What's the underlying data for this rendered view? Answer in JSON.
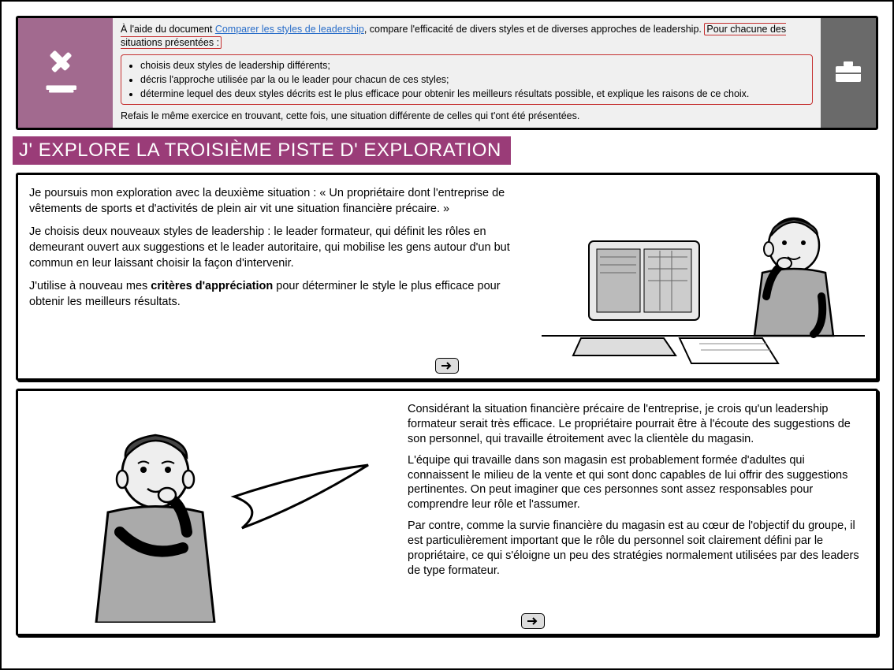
{
  "instruction": {
    "prefix": "À l'aide du document ",
    "link": "Comparer les styles de leadership",
    "mid": ", compare l'efficacité de divers styles et de diverses approches de leadership. ",
    "hl": "Pour chacune des situations présentées :",
    "bullets": [
      "choisis deux styles de leadership différents;",
      "décris l'approche utilisée par la ou le leader pour chacun de ces styles;",
      "détermine lequel des deux styles décrits est le plus efficace pour obtenir les meilleurs résultats possible, et explique les raisons de ce choix."
    ],
    "footer": "Refais le même exercice en trouvant, cette fois, une situation différente de celles qui t'ont été présentées."
  },
  "section_title": "J' EXPLORE LA TROISIÈME PISTE D' EXPLORATION",
  "panel1": {
    "p1": "Je poursuis mon exploration avec la deuxième situation : « Un propriétaire dont l'entreprise de vêtements de sports et d'activités de plein air vit une situation financière précaire. »",
    "p2": "Je choisis deux nouveaux styles de leadership : le leader formateur, qui définit les rôles en demeurant ouvert aux suggestions et le leader autoritaire, qui mobilise les gens autour d'un but commun en leur laissant choisir la façon d'intervenir.",
    "p3a": "J'utilise à nouveau mes ",
    "p3b": "critères d'appréciation",
    "p3c": " pour déterminer le style le plus efficace pour obtenir les meilleurs résultats."
  },
  "panel2": {
    "p1": "Considérant la situation financière précaire de l'entreprise, je crois qu'un leadership formateur serait très efficace. Le propriétaire pourrait être à l'écoute des suggestions de son personnel, qui travaille étroitement avec la clientèle du magasin.",
    "p2": "L'équipe qui travaille dans son magasin est probablement formée d'adultes qui connaissent le milieu de la vente et qui sont donc capables de lui offrir des suggestions pertinentes. On peut imaginer que ces personnes sont assez responsables pour comprendre leur rôle et l'assumer.",
    "p3": "Par contre, comme la survie financière du magasin est au cœur de l'objectif du groupe, il est particulièrement important que le rôle du personnel soit clairement défini par le propriétaire, ce qui s'éloigne un peu des stratégies normalement utilisées par des leaders de type formateur."
  }
}
